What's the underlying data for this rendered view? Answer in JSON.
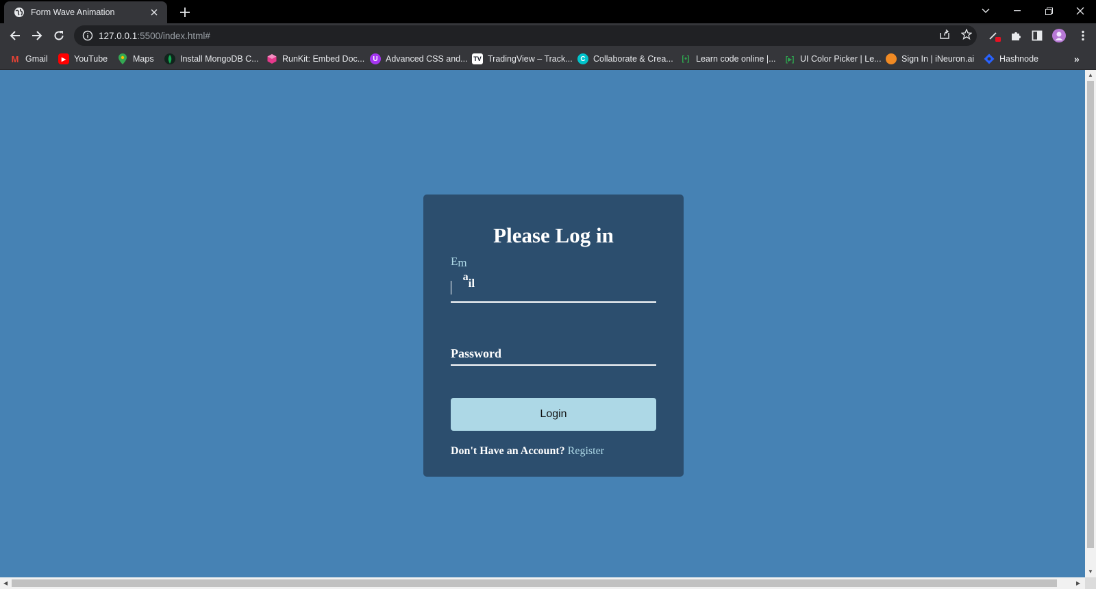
{
  "browser": {
    "tab_title": "Form Wave Animation",
    "url_host": "127.0.0.1",
    "url_rest": ":5500/index.html#",
    "bookmarks": [
      {
        "label": "Gmail",
        "icon": "gmail-icon",
        "color": "#ea4335"
      },
      {
        "label": "YouTube",
        "icon": "youtube-icon",
        "color": "#ff0000"
      },
      {
        "label": "Maps",
        "icon": "maps-icon",
        "color": "#34a853"
      },
      {
        "label": "Install MongoDB C...",
        "icon": "mongodb-icon",
        "color": "#13aa52"
      },
      {
        "label": "RunKit: Embed Doc...",
        "icon": "runkit-icon",
        "color": "#e6398c"
      },
      {
        "label": "Advanced CSS and...",
        "icon": "udemy-icon",
        "color": "#a435f0"
      },
      {
        "label": "TradingView – Track...",
        "icon": "tradingview-icon",
        "color": "#131722"
      },
      {
        "label": "Collaborate & Crea...",
        "icon": "canva-icon",
        "color": "#00c4cc"
      },
      {
        "label": "Learn code online |...",
        "icon": "scrimba-icon",
        "color": "#2ea44f"
      },
      {
        "label": "UI Color Picker | Le...",
        "icon": "colorpicker-icon",
        "color": "#2ea44f"
      },
      {
        "label": "Sign In | iNeuron.ai",
        "icon": "ineuron-icon",
        "color": "#f08a24"
      },
      {
        "label": "Hashnode",
        "icon": "hashnode-icon",
        "color": "#2962ff"
      }
    ]
  },
  "page": {
    "background": "#4682b4",
    "card_color": "#2c4e6e",
    "heading": "Please Log in",
    "email_label_letters": [
      "E",
      "m",
      "a",
      "il"
    ],
    "password_label": "Password",
    "login_button": "Login",
    "register_prompt": "Don't Have an Account?",
    "register_link": "Register",
    "button_color": "#add8e6"
  }
}
